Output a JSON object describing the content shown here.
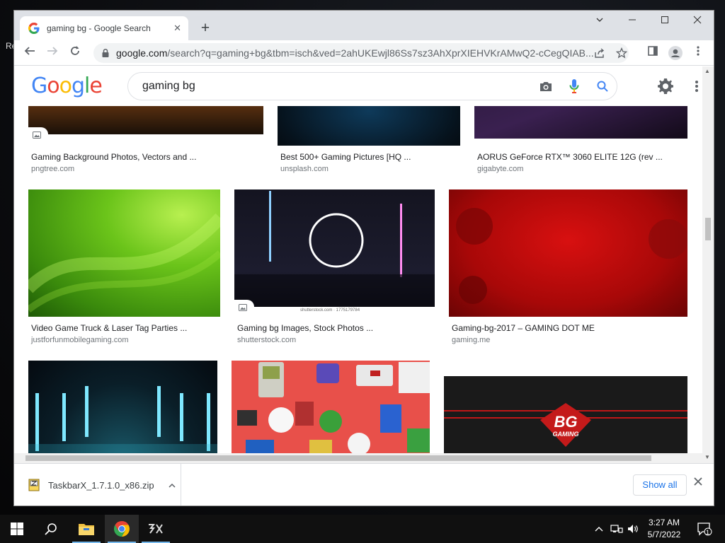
{
  "desktop": {
    "edge_text": "Re"
  },
  "browser": {
    "tab_title": "gaming bg - Google Search",
    "url_host": "google.com",
    "url_rest": "/search?q=gaming+bg&tbm=isch&ved=2ahUKEwjl86Ss7sz3AhXprXIEHVKrAMwQ2-cCegQIAB...",
    "new_tab": "+",
    "tab_close": "✕"
  },
  "search": {
    "logo_letters": [
      "G",
      "o",
      "o",
      "g",
      "l",
      "e"
    ],
    "logo_colors": [
      "#4285f4",
      "#ea4335",
      "#fbbc05",
      "#4285f4",
      "#34a853",
      "#ea4335"
    ],
    "query": "gaming bg"
  },
  "results": [
    {
      "title": "Gaming Background Photos, Vectors and ...",
      "source": "pngtree.com"
    },
    {
      "title": "Best 500+ Gaming Pictures [HQ ...",
      "source": "unsplash.com"
    },
    {
      "title": "AORUS GeForce RTX™ 3060 ELITE 12G (rev ...",
      "source": "gigabyte.com"
    },
    {
      "title": "Video Game Truck & Laser Tag Parties ...",
      "source": "justforfunmobilegaming.com"
    },
    {
      "title": "Gaming bg Images, Stock Photos ...",
      "source": "shutterstock.com",
      "watermark": "shutterstock.com · 1775179784"
    },
    {
      "title": "Gaming-bg-2017 – GAMING DOT ME",
      "source": "gaming.me"
    },
    {
      "title": "",
      "source": ""
    },
    {
      "title": "",
      "source": ""
    },
    {
      "title": "",
      "source": "",
      "logo_text": "BG",
      "logo_sub": "GAMING"
    }
  ],
  "download": {
    "filename": "TaskbarX_1.7.1.0_x86.zip",
    "show_all": "Show all"
  },
  "taskbar": {
    "time": "3:27 AM",
    "date": "5/7/2022",
    "notification_count": "1"
  }
}
